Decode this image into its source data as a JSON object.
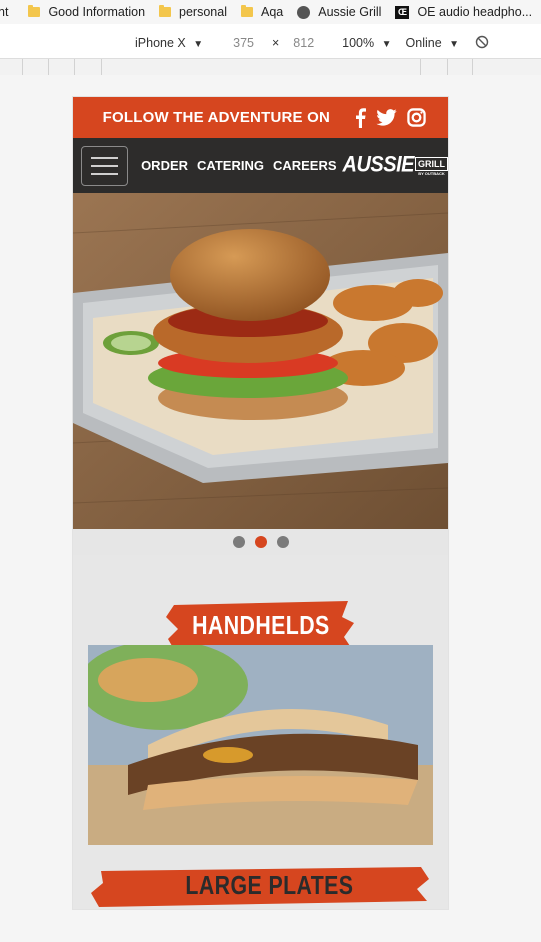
{
  "bookmarks": [
    {
      "label": "nt",
      "icon": "none"
    },
    {
      "label": "Good Information",
      "icon": "folder-icon"
    },
    {
      "label": "personal",
      "icon": "folder-icon"
    },
    {
      "label": "Aqa",
      "icon": "folder-icon"
    },
    {
      "label": "Aussie Grill",
      "icon": "globe-icon"
    },
    {
      "label": "OE audio headpho...",
      "icon": "oe-icon"
    }
  ],
  "devtools": {
    "device": "iPhone X",
    "width": "375",
    "times": "×",
    "height": "812",
    "zoom": "100%",
    "network": "Online",
    "rotate_icon": "rotate-icon"
  },
  "site": {
    "follow_text": "FOLLOW THE ADVENTURE ON",
    "social": [
      "facebook-icon",
      "twitter-icon",
      "instagram-icon"
    ],
    "nav": {
      "menu_icon": "hamburger-icon",
      "links": [
        "ORDER",
        "CATERING",
        "CAREERS"
      ],
      "logo_main": "AUSSIE",
      "logo_box": "GRILL",
      "logo_sub": "BY OUTBACK"
    },
    "carousel": {
      "count": 3,
      "active": 2
    },
    "sections": [
      {
        "title": "HANDHELDS"
      },
      {
        "title": "LARGE PLATES"
      }
    ]
  },
  "colors": {
    "accent": "#d6461f",
    "nav_bg": "#2d2c2b",
    "page_bg": "#e7e7e7"
  }
}
